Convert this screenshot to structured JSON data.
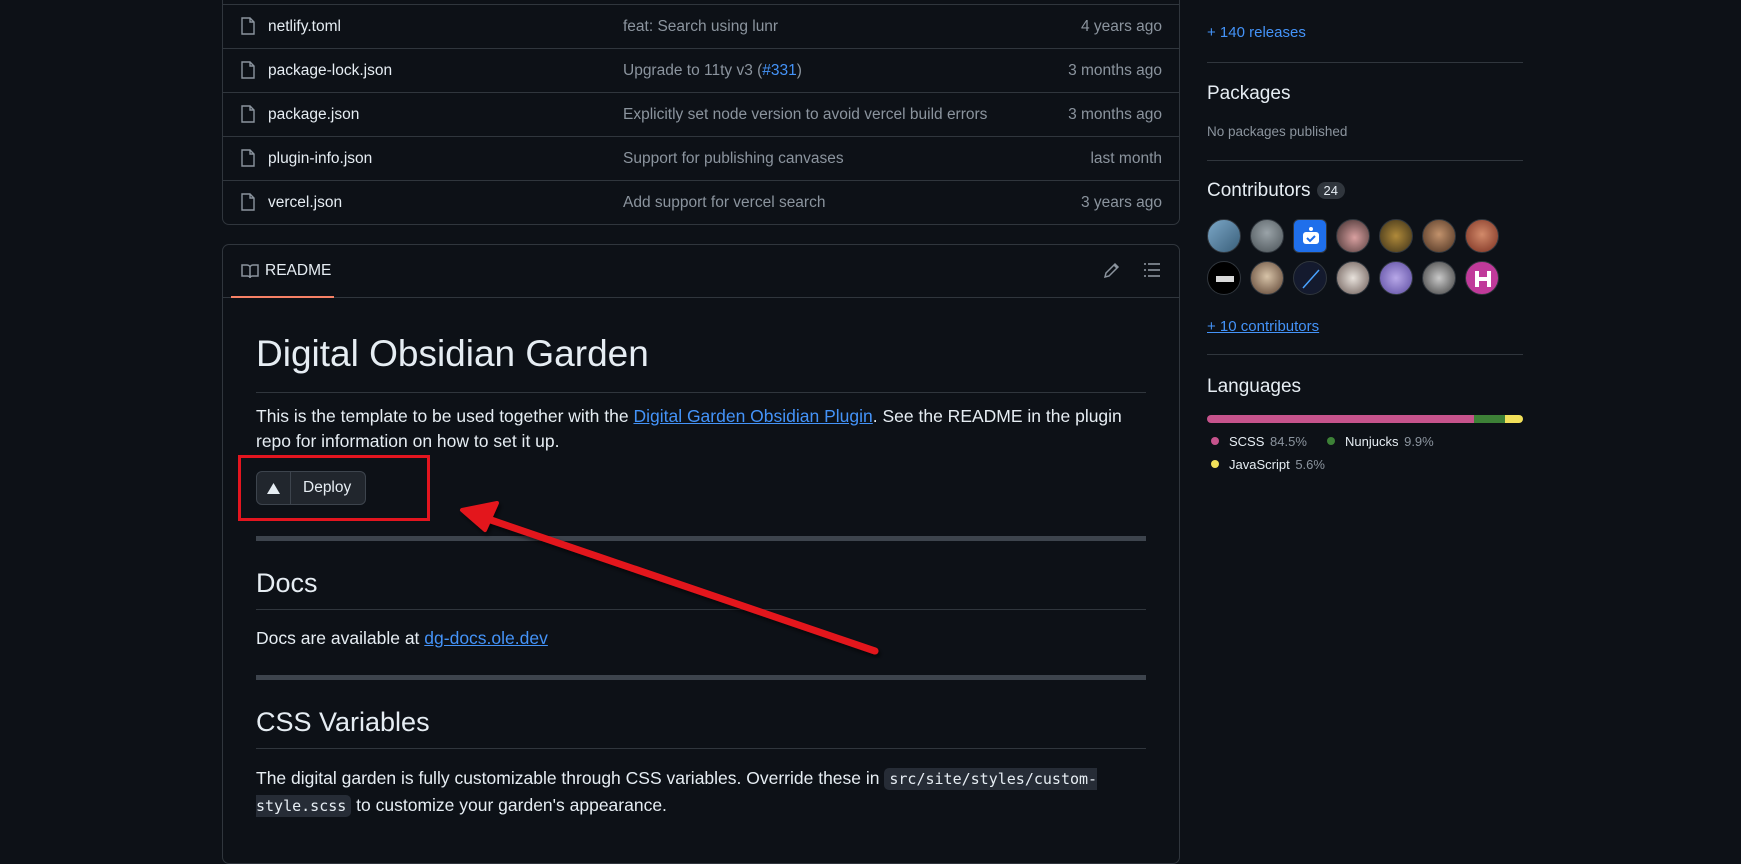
{
  "files": [
    {
      "name": "netlify.toml",
      "message": "feat: Search using lunr",
      "date": "4 years ago"
    },
    {
      "name": "package-lock.json",
      "message": "Upgrade to 11ty v3 (",
      "link": "#331",
      "message_end": ")",
      "date": "3 months ago"
    },
    {
      "name": "package.json",
      "message": "Explicitly set node version to avoid vercel build errors",
      "date": "3 months ago"
    },
    {
      "name": "plugin-info.json",
      "message": "Support for publishing canvases",
      "date": "last month"
    },
    {
      "name": "vercel.json",
      "message": "Add support for vercel search",
      "date": "3 years ago"
    }
  ],
  "readme": {
    "tab_label": "README",
    "title": "Digital Obsidian Garden",
    "intro_before": "This is the template to be used together with the ",
    "intro_link": "Digital Garden Obsidian Plugin",
    "intro_after": ". See the README in the plugin repo for information on how to set it up.",
    "deploy_label": "Deploy",
    "docs_heading": "Docs",
    "docs_text": "Docs are available at ",
    "docs_link": "dg-docs.ole.dev",
    "css_heading": "CSS Variables",
    "css_before": "The digital garden is fully customizable through CSS variables. Override these in ",
    "css_code": "src/site/styles/custom-style.scss",
    "css_after": " to customize your garden's appearance."
  },
  "sidebar": {
    "releases_link": "+ 140 releases",
    "packages_heading": "Packages",
    "packages_text": "No packages published",
    "contributors_heading": "Contributors",
    "contributors_count": "24",
    "more_contributors": "+ 10 contributors",
    "languages_heading": "Languages",
    "languages": [
      {
        "name": "SCSS",
        "pct": "84.5%",
        "value": 84.5,
        "color": "#c6538c"
      },
      {
        "name": "Nunjucks",
        "pct": "9.9%",
        "value": 9.9,
        "color": "#3d8137"
      },
      {
        "name": "JavaScript",
        "pct": "5.6%",
        "value": 5.6,
        "color": "#f1e05a"
      }
    ]
  },
  "colors": {
    "annotation_red": "#e3151f",
    "accent_link": "#4493f8"
  }
}
